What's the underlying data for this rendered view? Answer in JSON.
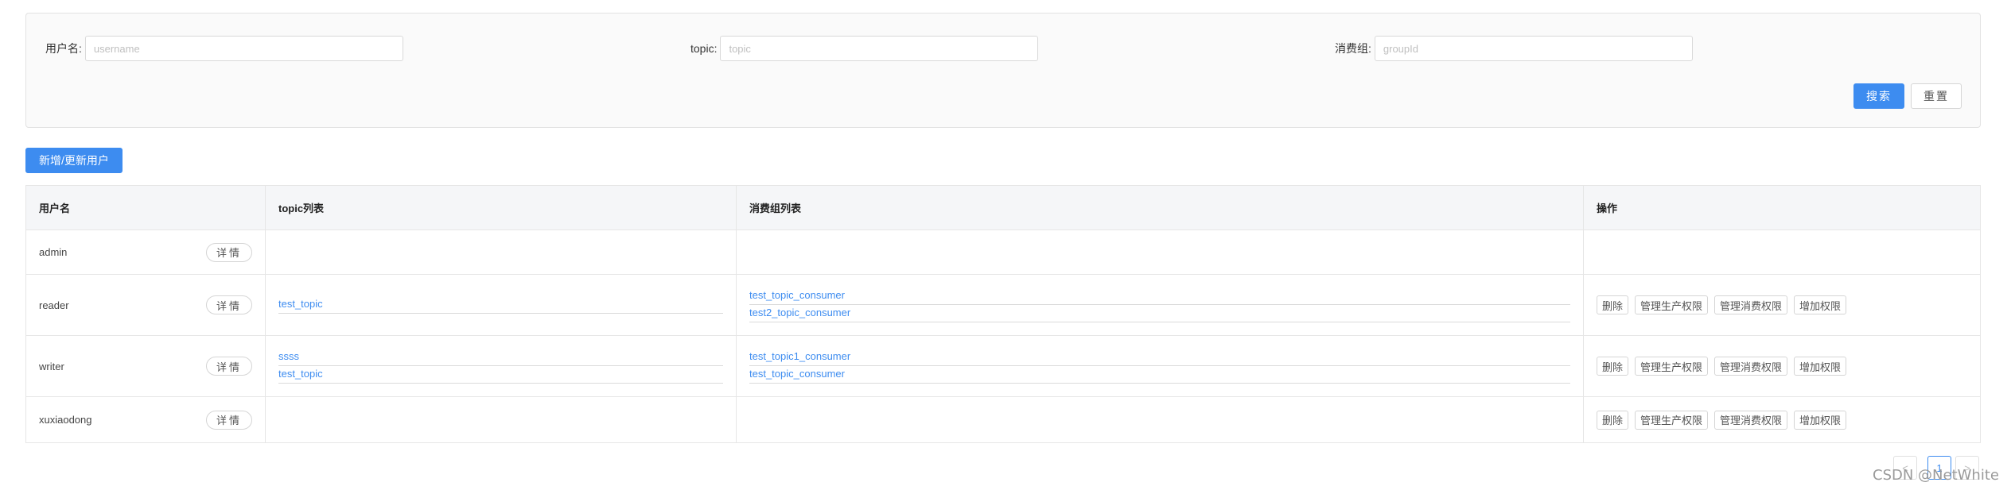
{
  "search": {
    "username_label": "用户名:",
    "username_placeholder": "username",
    "topic_label": "topic:",
    "topic_placeholder": "topic",
    "group_label": "消费组:",
    "group_placeholder": "groupId",
    "search_button": "搜索",
    "reset_button": "重置"
  },
  "add_button": "新增/更新用户",
  "table": {
    "headers": [
      "用户名",
      "topic列表",
      "消费组列表",
      "操作"
    ],
    "detail_label": "详情",
    "actions": [
      "删除",
      "管理生产权限",
      "管理消费权限",
      "增加权限"
    ],
    "rows": [
      {
        "username": "admin",
        "topics": [],
        "groups": []
      },
      {
        "username": "reader",
        "topics": [
          "test_topic"
        ],
        "groups": [
          "test_topic_consumer",
          "test2_topic_consumer"
        ]
      },
      {
        "username": "writer",
        "topics": [
          "ssss",
          "test_topic"
        ],
        "groups": [
          "test_topic1_consumer",
          "test_topic_consumer"
        ]
      },
      {
        "username": "xuxiaodong",
        "topics": [],
        "groups": []
      }
    ]
  },
  "pagination": {
    "prev": "<",
    "current": "1",
    "next": ">"
  },
  "watermark": "CSDN @NetWhite"
}
